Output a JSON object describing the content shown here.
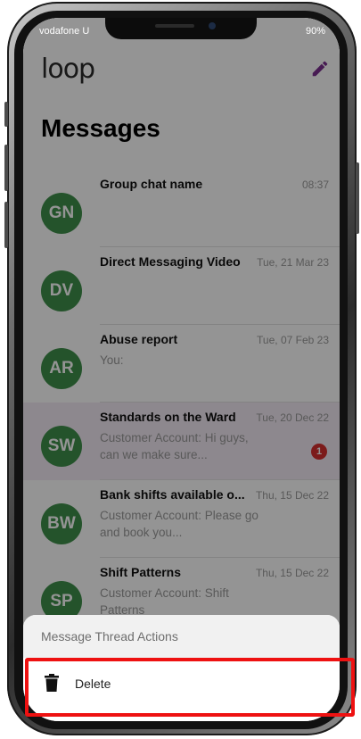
{
  "status_bar": {
    "carrier": "vodafone U",
    "battery": "90%"
  },
  "header": {
    "logo": "loop",
    "title": "Messages"
  },
  "threads": [
    {
      "initials": "GN",
      "name": "Group chat name",
      "date": "08:37",
      "preview": "",
      "unread": ""
    },
    {
      "initials": "DV",
      "name": "Direct Messaging Video",
      "date": "Tue, 21 Mar 23",
      "preview": "",
      "unread": ""
    },
    {
      "initials": "AR",
      "name": "Abuse report",
      "date": "Tue, 07 Feb 23",
      "preview": "You:",
      "unread": ""
    },
    {
      "initials": "SW",
      "name": "Standards on the Ward",
      "date": "Tue, 20 Dec 22",
      "preview": "Customer Account: Hi guys, can we make sure...",
      "unread": "1"
    },
    {
      "initials": "BW",
      "name": "Bank shifts available o...",
      "date": "Thu, 15 Dec 22",
      "preview": "Customer Account: Please go and book you...",
      "unread": ""
    },
    {
      "initials": "SP",
      "name": "Shift Patterns",
      "date": "Thu, 15 Dec 22",
      "preview": "Customer Account: Shift Patterns",
      "unread": ""
    }
  ],
  "action_sheet": {
    "title": "Message Thread Actions",
    "delete_label": "Delete"
  },
  "colors": {
    "avatar": "#3f8f4a",
    "badge": "#d62f2f",
    "highlight": "#ee1111",
    "accent": "#7a2f8f"
  }
}
